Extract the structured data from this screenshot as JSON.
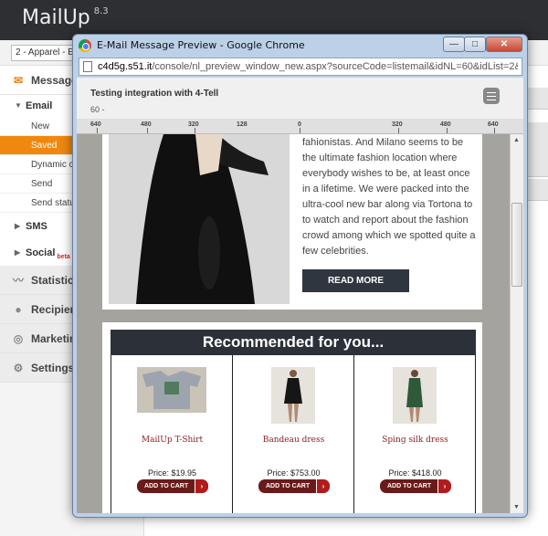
{
  "app": {
    "name": "MailUp",
    "version": "8.3"
  },
  "topbar": {
    "list_select": "2 - Apparel - E"
  },
  "sidebar": {
    "messages": "Messages",
    "email": "Email",
    "email_items": [
      {
        "label": "New",
        "selected": false
      },
      {
        "label": "Saved",
        "selected": true
      },
      {
        "label": "Dynamic c",
        "selected": false
      },
      {
        "label": "Send",
        "selected": false
      },
      {
        "label": "Send status",
        "selected": false
      }
    ],
    "sms": "SMS",
    "social": "Social",
    "social_badge": "beta",
    "statistics": "Statistics",
    "recipients": "Recipients",
    "marketing": "Marketing",
    "settings": "Settings",
    "accent_color": "#f0880e"
  },
  "popup": {
    "title": "E-Mail Message Preview - Google Chrome",
    "url_domain": "c4d5g.s51.it",
    "url_path": "/console/nl_preview_window_new.aspx?sourceCode=listemail&idNL=60&idList=2&",
    "preview_title": "Testing integration with 4-Tell",
    "preview_count": "60 -",
    "ruler": [
      "640",
      "480",
      "320",
      "128",
      "0",
      "320",
      "480",
      "640"
    ],
    "article": "fahionistas. And Milano seems to be the ultimate fashion location where everybody wishes to be, at least once in a lifetime. We were packed into the ultra-cool new bar along via Tortona to to watch and report about the fashion crowd among which we spotted quite a few celebrities.",
    "read_more": "READ MORE",
    "recommended": "Recommended for you...",
    "products": [
      {
        "name": "MailUp T-Shirt",
        "price": "Price: $19.95",
        "cart": "ADD TO CART"
      },
      {
        "name": "Bandeau dress",
        "price": "Price: $753.00",
        "cart": "ADD TO CART"
      },
      {
        "name": "Sping silk dress",
        "price": "Price: $418.00",
        "cart": "ADD TO CART"
      }
    ]
  }
}
